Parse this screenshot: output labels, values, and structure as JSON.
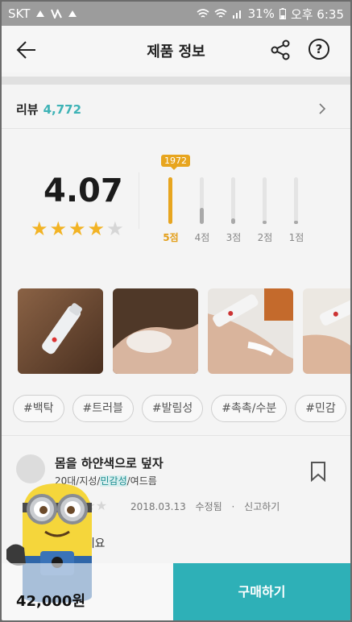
{
  "statusbar": {
    "carrier": "SKT",
    "battery": "31%",
    "time": "오후 6:35"
  },
  "header": {
    "title": "제품 정보",
    "back_icon": "arrow-left-icon",
    "share_icon": "share-icon",
    "help_label": "?"
  },
  "review_summary": {
    "label": "리뷰",
    "count": "4,772"
  },
  "rating": {
    "score": "4.07",
    "score_value": 4.07,
    "stars_filled": 4,
    "stars_total": 5
  },
  "distribution": {
    "top_count": "1972",
    "bars": [
      {
        "label": "5점",
        "fraction": 1.0,
        "active": true
      },
      {
        "label": "4점",
        "fraction": 0.35,
        "active": false
      },
      {
        "label": "3점",
        "fraction": 0.12,
        "active": false
      },
      {
        "label": "2점",
        "fraction": 0.05,
        "active": false
      },
      {
        "label": "1점",
        "fraction": 0.03,
        "active": false
      }
    ]
  },
  "tags": [
    "#백탁",
    "#트러블",
    "#발림성",
    "#촉촉/수분",
    "#민감"
  ],
  "review": {
    "title": "몸을 하얀색으로 덮자",
    "meta_prefix": "20대/지성/",
    "meta_highlight": "민감성",
    "meta_suffix": "/여드름",
    "date": "2018.03.13",
    "edited": "수정됨",
    "report": "신고하기",
    "body_line1": "안녕하세요",
    "bookmark_icon": "bookmark-icon"
  },
  "purchase": {
    "price": "42,000원",
    "buy_label": "구매하기",
    "accent_color": "#2eb0b7"
  }
}
